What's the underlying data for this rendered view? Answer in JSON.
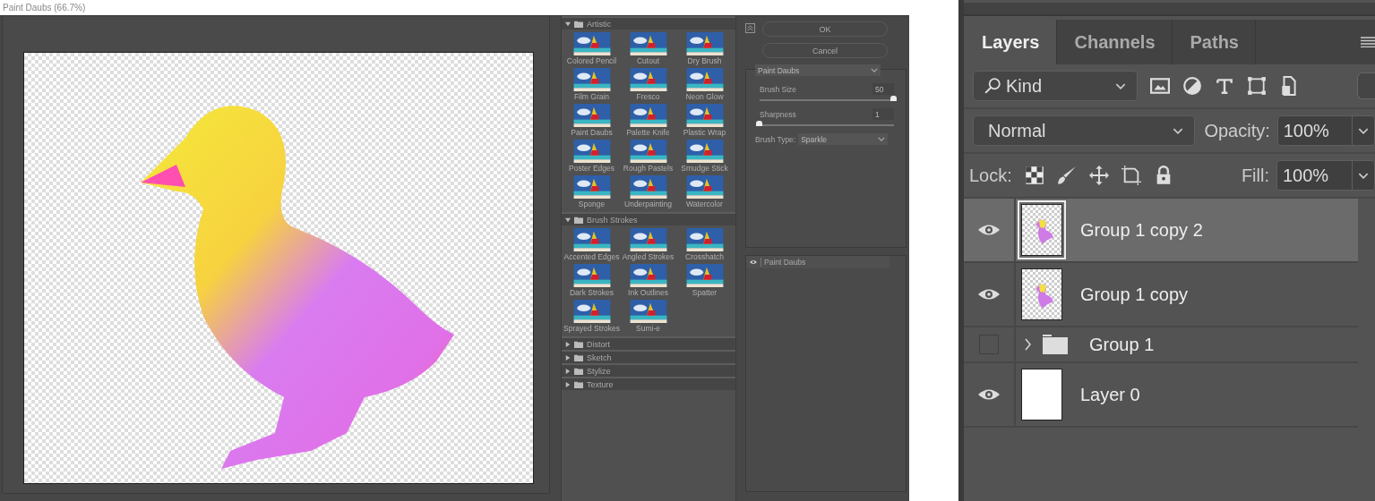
{
  "window": {
    "title": "Paint Daubs (66.7%)"
  },
  "gallery": {
    "categories": [
      {
        "name": "Artistic",
        "expanded": true,
        "filters": [
          "Colored Pencil",
          "Cutout",
          "Dry Brush",
          "Film Grain",
          "Fresco",
          "Neon Glow",
          "Paint Daubs",
          "Palette Knife",
          "Plastic Wrap",
          "Poster Edges",
          "Rough Pastels",
          "Smudge Stick",
          "Sponge",
          "Underpainting",
          "Watercolor"
        ]
      },
      {
        "name": "Brush Strokes",
        "expanded": true,
        "filters": [
          "Accented Edges",
          "Angled Strokes",
          "Crosshatch",
          "Dark Strokes",
          "Ink Outlines",
          "Spatter",
          "Sprayed Strokes",
          "Sumi-e"
        ]
      },
      {
        "name": "Distort",
        "expanded": false
      },
      {
        "name": "Sketch",
        "expanded": false
      },
      {
        "name": "Stylize",
        "expanded": false
      },
      {
        "name": "Texture",
        "expanded": false
      }
    ]
  },
  "settings": {
    "buttons": [
      "OK",
      "Cancel"
    ],
    "filter": "Paint Daubs",
    "sliders": [
      {
        "label": "Brush Size",
        "value": "50",
        "level": 1
      },
      {
        "label": "Sharpness",
        "value": "1",
        "level": 0
      }
    ],
    "brush_type": {
      "label": "Brush Type:",
      "value": "Sparkle"
    },
    "effect_layers": [
      {
        "name": "Paint Daubs",
        "visible": true
      }
    ]
  },
  "layers_panel": {
    "tabs": [
      {
        "label": "Layers",
        "selected": true
      },
      {
        "label": "Channels",
        "selected": false
      },
      {
        "label": "Paths",
        "selected": false
      }
    ],
    "filter": "Kind",
    "blend_mode": "Normal",
    "opacity_label": "Opacity:",
    "opacity": "100%",
    "lock_label": "Lock:",
    "fill_label": "Fill:",
    "fill": "100%",
    "layers": [
      {
        "name": "Group 1 copy 2",
        "kind": "image",
        "visible": true,
        "selected": true
      },
      {
        "name": "Group 1 copy",
        "kind": "image",
        "visible": true,
        "selected": false
      },
      {
        "name": "Group 1",
        "kind": "group",
        "visible": false,
        "selected": false
      },
      {
        "name": "Layer 0",
        "kind": "white",
        "visible": true,
        "selected": false
      }
    ]
  }
}
